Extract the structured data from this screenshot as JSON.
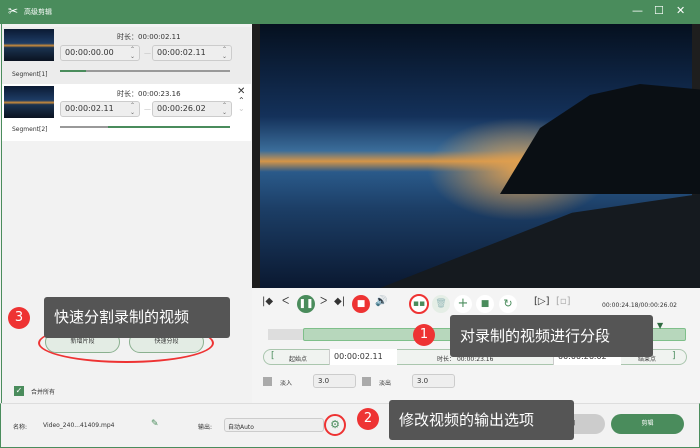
{
  "window": {
    "title": "高级剪辑",
    "logo": "scissors-logo"
  },
  "segments": [
    {
      "name": "Segment[1]",
      "duration_label": "时长：",
      "duration": "00:00:02.11",
      "start": "00:00:00.00",
      "end": "00:00:02.11",
      "progress": 0.15
    },
    {
      "name": "Segment[2]",
      "duration_label": "时长：",
      "duration": "00:00:23.16",
      "start": "00:00:02.11",
      "end": "00:00:26.02",
      "progress": 0.28
    }
  ],
  "left_actions": {
    "add_segment": "新增片段",
    "quick_split": "快速分段",
    "merge_all": "合并所有",
    "merge_checked": true
  },
  "player": {
    "time": "00:00:24.18/00:00:26.02"
  },
  "range": {
    "start_label": "起始点",
    "start": "00:00:02.11",
    "duration_label": "时长：",
    "duration": "00:00:23.16",
    "end": "00:00:26.02",
    "end_label": "结束点"
  },
  "fade": {
    "in_label": "淡入",
    "in_value": "3.0",
    "out_label": "淡出",
    "out_value": "3.0"
  },
  "bottom": {
    "name_label": "名称:",
    "file_name": "Video_240...41409.mp4",
    "output_label": "输出:",
    "output_value": "自动Auto",
    "back": "返回",
    "cut": "剪辑"
  },
  "annotations": {
    "n1": "1",
    "tip1": "对录制的视频进行分段",
    "n2": "2",
    "tip2": "修改视频的输出选项",
    "n3": "3",
    "tip3": "快速分割录制的视频"
  },
  "colors": {
    "brand": "#4a8c5c",
    "annotation": "#e33333"
  }
}
